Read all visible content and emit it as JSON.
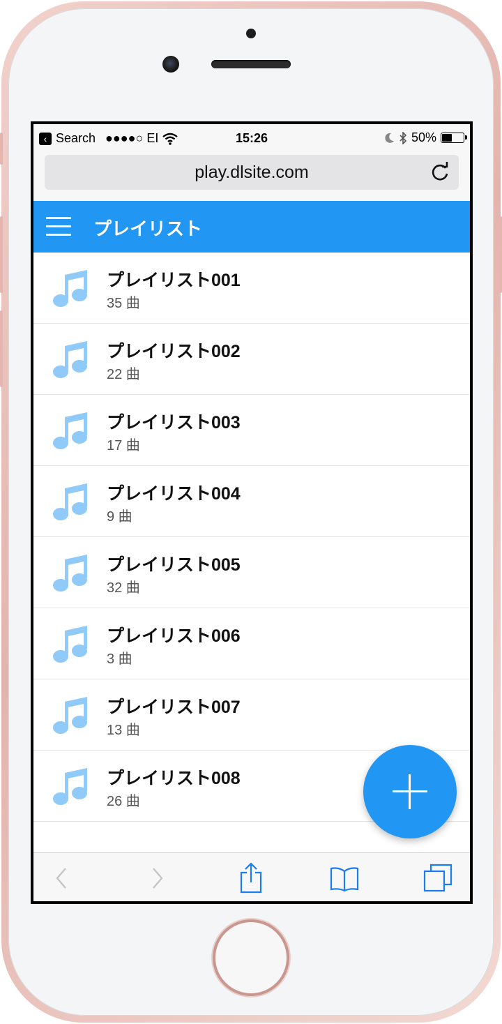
{
  "status_bar": {
    "back_app": "Search",
    "carrier": "●●●●○ EI",
    "time": "15:26",
    "battery": "50%",
    "battery_level": 0.5
  },
  "browser": {
    "url": "play.dlsite.com"
  },
  "app_bar": {
    "title": "プレイリスト"
  },
  "playlists": [
    {
      "name": "プレイリスト001",
      "count": "35 曲"
    },
    {
      "name": "プレイリスト002",
      "count": "22 曲"
    },
    {
      "name": "プレイリスト003",
      "count": "17 曲"
    },
    {
      "name": "プレイリスト004",
      "count": "9 曲"
    },
    {
      "name": "プレイリスト005",
      "count": "32 曲"
    },
    {
      "name": "プレイリスト006",
      "count": "3 曲"
    },
    {
      "name": "プレイリスト007",
      "count": "13 曲"
    },
    {
      "name": "プレイリスト008",
      "count": "26 曲"
    }
  ],
  "icons": {
    "playlist": "music-note-icon",
    "fab": "plus-icon",
    "menu": "hamburger-menu-icon"
  },
  "colors": {
    "accent": "#2196f3",
    "note_icon": "#90caf9",
    "toolbar_icon": "#1a7cf0"
  }
}
